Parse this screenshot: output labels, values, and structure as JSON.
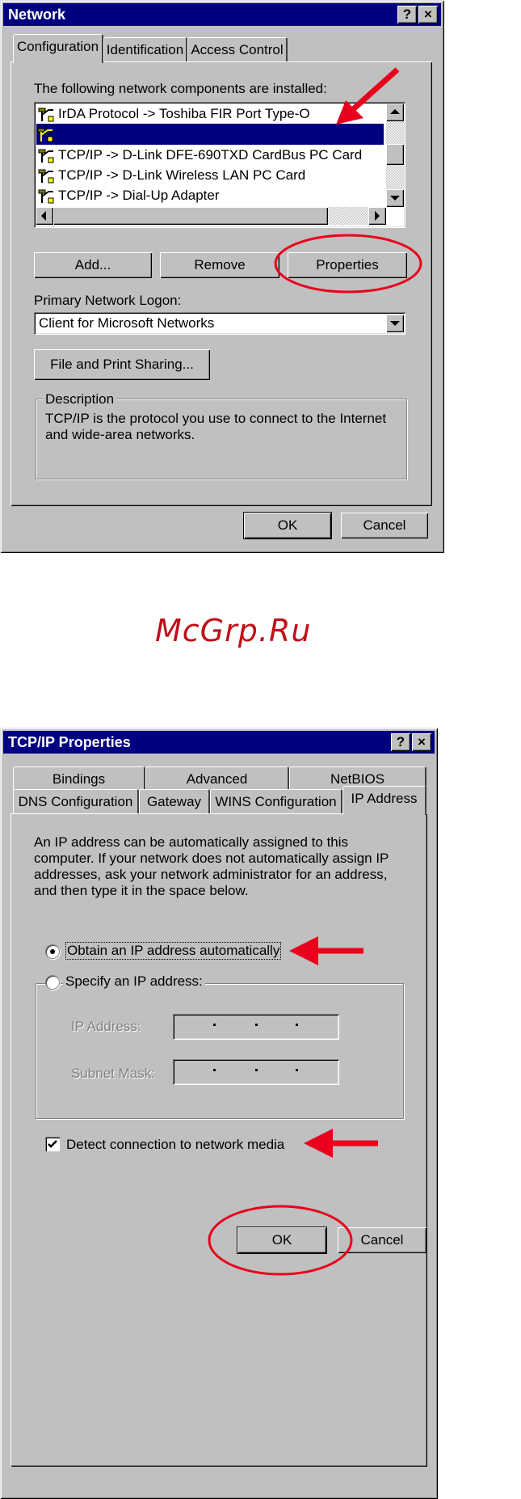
{
  "network_dialog": {
    "title": "Network",
    "help_button": "?",
    "close_button": "×",
    "tabs": [
      {
        "label": "Configuration",
        "active": true
      },
      {
        "label": "Identification",
        "active": false
      },
      {
        "label": "Access Control",
        "active": false
      }
    ],
    "components_label": "The following network components are installed:",
    "components": [
      "IrDA Protocol -> Toshiba FIR Port Type-O",
      "",
      "TCP/IP -> D-Link DFE-690TXD CardBus PC Card",
      "TCP/IP -> D-Link Wireless LAN PC Card",
      "TCP/IP -> Dial-Up Adapter"
    ],
    "selected_index": 1,
    "add_button": "Add...",
    "remove_button": "Remove",
    "properties_button": "Properties",
    "primary_logon_label": "Primary Network Logon:",
    "primary_logon_value": "Client for Microsoft Networks",
    "file_print_button": "File and Print Sharing...",
    "description_label": "Description",
    "description_text": "TCP/IP is the protocol you use to connect to the Internet and wide-area networks.",
    "ok_button": "OK",
    "cancel_button": "Cancel"
  },
  "watermark": "McGrp.Ru",
  "tcpip_dialog": {
    "title": "TCP/IP Properties",
    "help_button": "?",
    "close_button": "×",
    "tabs_back": [
      "Bindings",
      "Advanced",
      "NetBIOS"
    ],
    "tabs_front": [
      "DNS Configuration",
      "Gateway",
      "WINS Configuration",
      "IP Address"
    ],
    "active_tab": "IP Address",
    "intro_text": "An IP address can be automatically assigned to this computer. If your network does not automatically assign IP addresses, ask your network administrator for an address, and then type it in the space below.",
    "obtain_auto_label": "Obtain an IP address automatically",
    "obtain_auto_selected": true,
    "specify_label": "Specify an IP address:",
    "ip_address_label": "IP Address:",
    "subnet_mask_label": "Subnet Mask:",
    "detect_label": "Detect connection to network media",
    "detect_checked": true,
    "ok_button": "OK",
    "cancel_button": "Cancel"
  },
  "colors": {
    "title_bar": "#000080",
    "dialog_face": "#c0c0c0",
    "annotation_red": "#e8001c",
    "watermark": "#c0101a"
  }
}
